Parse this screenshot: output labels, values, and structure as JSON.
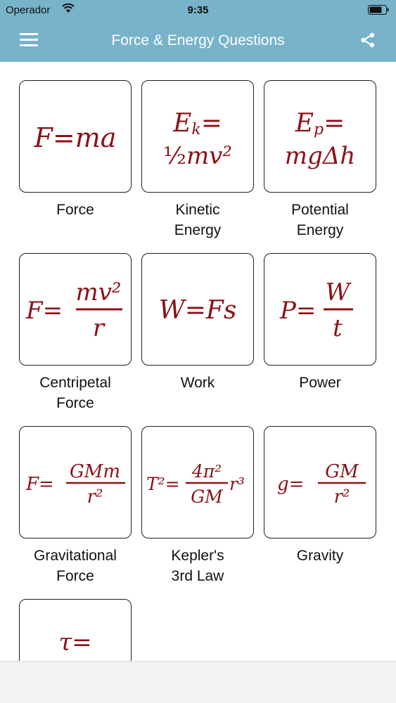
{
  "status_bar": {
    "carrier": "Operador",
    "time": "9:35"
  },
  "header": {
    "title": "Force & Energy Questions",
    "menu_icon": "hamburger-menu-icon",
    "share_icon": "share-icon"
  },
  "colors": {
    "header_bg": "#78b3c9",
    "formula": "#8b1117",
    "card_border": "#1f1f1f"
  },
  "items": [
    {
      "label": "Force",
      "formula": "F=ma"
    },
    {
      "label": "Kinetic\nEnergy",
      "formula": "Ek= ½mv²"
    },
    {
      "label": "Potential\nEnergy",
      "formula": "Ep= mgΔh"
    },
    {
      "label": "Centripetal\nForce",
      "formula": "F=mv²/r"
    },
    {
      "label": "Work",
      "formula": "W=Fs"
    },
    {
      "label": "Power",
      "formula": "P=W/t"
    },
    {
      "label": "Gravitational\nForce",
      "formula": "F=GMm/r²"
    },
    {
      "label": "Kepler's\n3rd Law",
      "formula": "T²=4π²/GM r³"
    },
    {
      "label": "Gravity",
      "formula": "g=GM/r²"
    },
    {
      "label": "",
      "formula": "τ="
    }
  ]
}
